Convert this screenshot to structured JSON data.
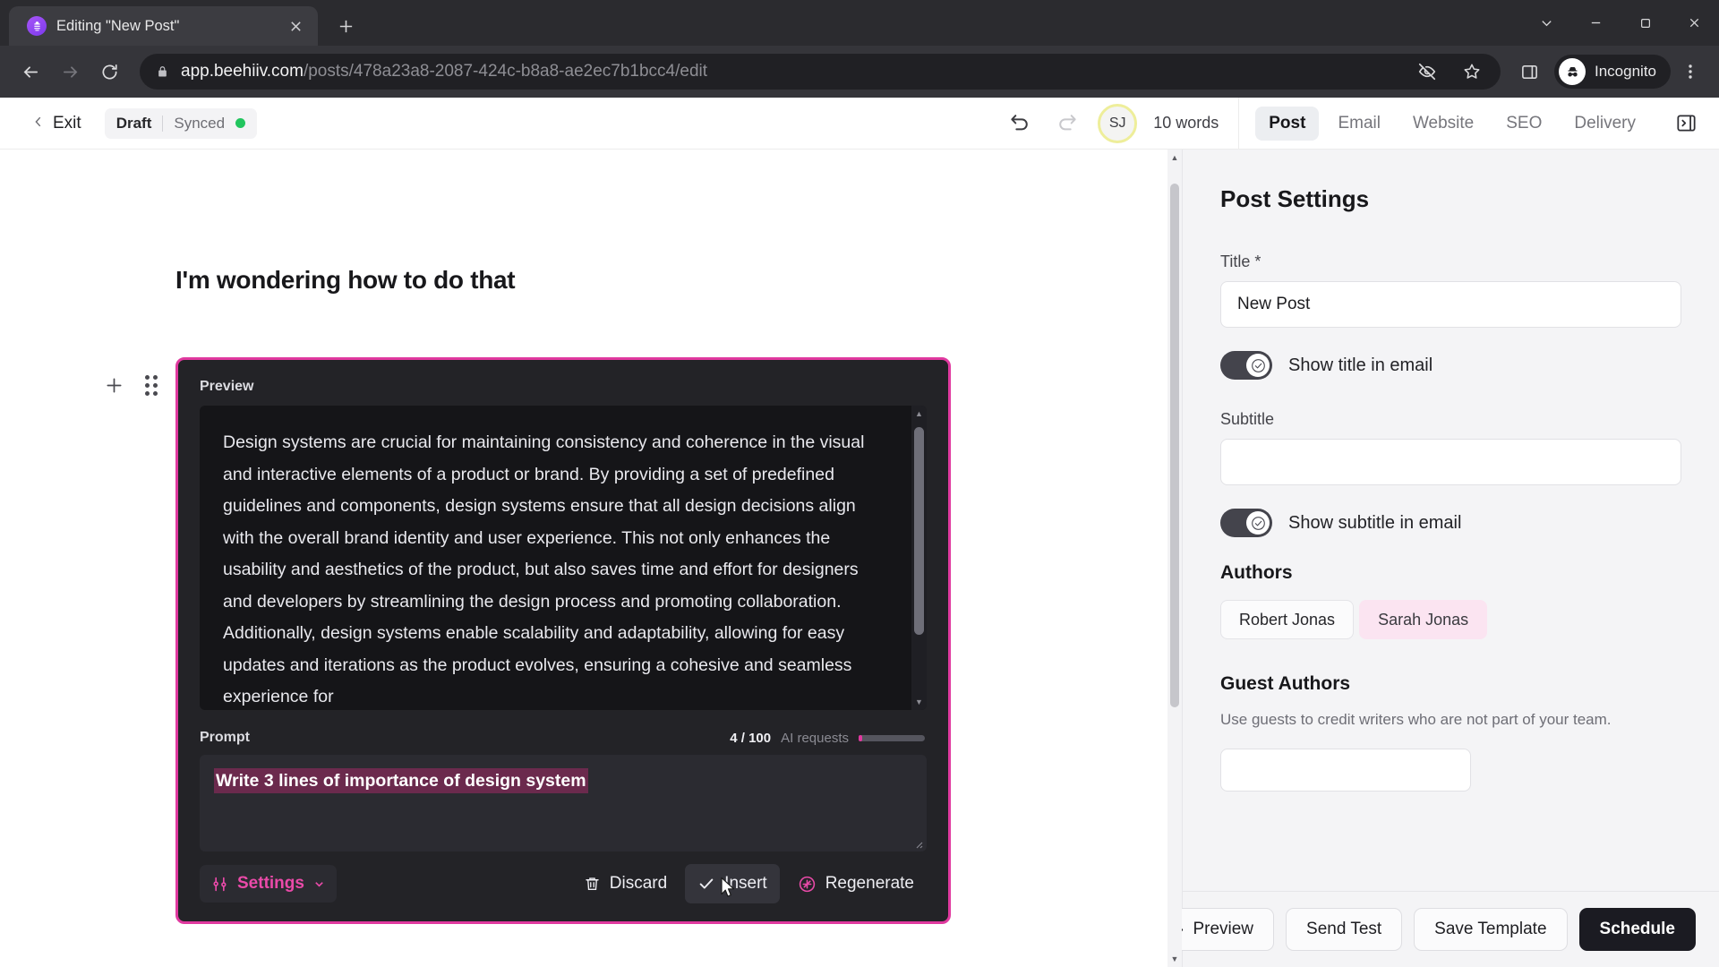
{
  "browser": {
    "tab": {
      "title": "Editing \"New Post\"",
      "favicon_icon": "beehiiv-logo-icon",
      "close_icon": "close-icon"
    },
    "new_tab_icon": "plus-icon",
    "window_controls": {
      "minimize_more_icon": "chevron-down-icon",
      "minimize_icon": "minimize-icon",
      "maximize_icon": "maximize-icon",
      "close_icon": "close-icon"
    },
    "nav": {
      "back_icon": "arrow-back-icon",
      "forward_icon": "arrow-forward-icon",
      "reload_icon": "reload-icon"
    },
    "omnibox": {
      "lock_icon": "lock-icon",
      "domain": "app.beehiiv.com",
      "path": "/posts/478a23a8-2087-424c-b8a8-ae2ec7b1bcc4/edit",
      "full_url": "app.beehiiv.com/posts/478a23a8-2087-424c-b8a8-ae2ec7b1bcc4/edit"
    },
    "actions": {
      "tracking_icon": "eye-off-icon",
      "bookmark_icon": "star-icon",
      "side_panel_icon": "side-panel-icon",
      "incognito_icon": "incognito-hat-icon",
      "incognito_label": "Incognito",
      "menu_icon": "kebab-menu-icon"
    }
  },
  "appbar": {
    "back_icon": "chevron-left-icon",
    "exit_label": "Exit",
    "status": {
      "draft": "Draft",
      "synced": "Synced",
      "dot_color": "#22c55e"
    },
    "undo_icon": "undo-icon",
    "redo_icon": "redo-icon",
    "avatar_initials": "SJ",
    "avatar_ring_color": "#eeee9a",
    "word_count": "10 words",
    "tabs": [
      {
        "label": "Post",
        "active": true
      },
      {
        "label": "Email",
        "active": false
      },
      {
        "label": "Website",
        "active": false
      },
      {
        "label": "SEO",
        "active": false
      },
      {
        "label": "Delivery",
        "active": false
      }
    ],
    "panel_toggle_icon": "collapse-panel-icon"
  },
  "editor": {
    "doc_title": "I'm wondering how to do that",
    "add_block_icon": "plus-icon",
    "drag_handle_icon": "drag-handle-icon",
    "ai_card": {
      "accent_color": "#e0399f",
      "preview_label": "Preview",
      "preview_text": "Design systems are crucial for maintaining consistency and coherence in the visual and interactive elements of a product or brand. By providing a set of predefined guidelines and components, design systems ensure that all design decisions align with the overall brand identity and user experience. This not only enhances the usability and aesthetics of the product, but also saves time and effort for designers and developers by streamlining the design process and promoting collaboration. Additionally, design systems enable scalability and adaptability, allowing for easy updates and iterations as the product evolves, ensuring a cohesive and seamless experience for",
      "prompt_label": "Prompt",
      "requests_count": "4 / 100",
      "requests_text": "AI requests",
      "prompt_value": "Write 3 lines of importance of design system",
      "settings_label": "Settings",
      "settings_icon": "sliders-icon",
      "settings_chevron_icon": "chevron-down-icon",
      "discard_label": "Discard",
      "discard_icon": "trash-icon",
      "insert_label": "Insert",
      "insert_icon": "check-icon",
      "regenerate_label": "Regenerate",
      "regenerate_icon": "sparkle-refresh-icon",
      "scroll_up_icon": "triangle-up-icon",
      "scroll_down_icon": "triangle-down-icon"
    }
  },
  "panel": {
    "heading": "Post Settings",
    "title_label": "Title *",
    "title_value": "New Post",
    "show_title_label": "Show title in email",
    "show_title_on": true,
    "subtitle_label": "Subtitle",
    "subtitle_value": "",
    "show_subtitle_label": "Show subtitle in email",
    "show_subtitle_on": true,
    "authors_heading": "Authors",
    "authors": [
      {
        "name": "Robert Jonas",
        "highlighted": false
      },
      {
        "name": "Sarah Jonas",
        "highlighted": true
      }
    ],
    "guest_heading": "Guest Authors",
    "guest_note": "Use guests to credit writers who are not part of your team.",
    "toggle_check_icon": "check-circle-icon",
    "footer": {
      "preview_label": "Preview",
      "preview_icon": "eye-icon",
      "send_test_label": "Send Test",
      "save_template_label": "Save Template",
      "schedule_label": "Schedule"
    }
  }
}
